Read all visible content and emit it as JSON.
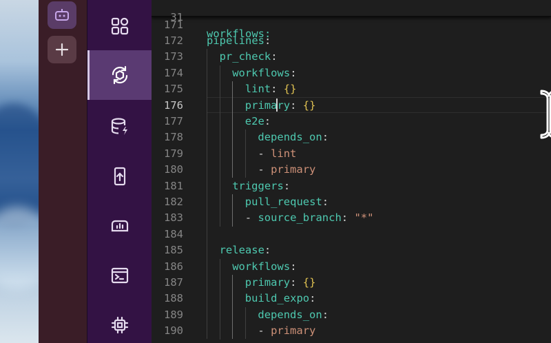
{
  "workspace": {
    "active_icon": "robot-icon",
    "add_icon": "plus-icon"
  },
  "activity_bar": {
    "items": [
      {
        "icon": "apps-grid-icon",
        "active": false
      },
      {
        "icon": "workflow-sync-icon",
        "active": true
      },
      {
        "icon": "database-bolt-icon",
        "active": false
      },
      {
        "icon": "mobile-upload-icon",
        "active": false
      },
      {
        "icon": "dashboard-gauge-icon",
        "active": false
      },
      {
        "icon": "terminal-icon",
        "active": false
      },
      {
        "icon": "chip-icon",
        "active": false
      }
    ],
    "active_color": "#5a3a72",
    "background": "#331244"
  },
  "editor": {
    "sticky": {
      "num": "31",
      "text": "workflows:"
    },
    "current_line": "176",
    "lines": [
      {
        "num": "171",
        "indent": 0,
        "tokens": []
      },
      {
        "num": "172",
        "indent": 0,
        "tokens": [
          {
            "t": "pipelines",
            "c": "k"
          },
          {
            "t": ":",
            "c": "p"
          }
        ]
      },
      {
        "num": "173",
        "indent": 1,
        "tokens": [
          {
            "t": "pr_check",
            "c": "k"
          },
          {
            "t": ":",
            "c": "p"
          }
        ]
      },
      {
        "num": "174",
        "indent": 2,
        "tokens": [
          {
            "t": "workflows",
            "c": "k"
          },
          {
            "t": ":",
            "c": "p"
          }
        ]
      },
      {
        "num": "175",
        "indent": 3,
        "tokens": [
          {
            "t": "lint",
            "c": "k"
          },
          {
            "t": ": ",
            "c": "p"
          },
          {
            "t": "{}",
            "c": "b"
          }
        ]
      },
      {
        "num": "176",
        "indent": 3,
        "tokens": [
          {
            "t": "primary",
            "c": "k"
          },
          {
            "t": ": ",
            "c": "p"
          },
          {
            "t": "{}",
            "c": "b"
          }
        ]
      },
      {
        "num": "177",
        "indent": 3,
        "tokens": [
          {
            "t": "e2e",
            "c": "k"
          },
          {
            "t": ":",
            "c": "p"
          }
        ]
      },
      {
        "num": "178",
        "indent": 4,
        "tokens": [
          {
            "t": "depends_on",
            "c": "k"
          },
          {
            "t": ":",
            "c": "p"
          }
        ]
      },
      {
        "num": "179",
        "indent": 4,
        "tokens": [
          {
            "t": "- ",
            "c": "p"
          },
          {
            "t": "lint",
            "c": "s"
          }
        ]
      },
      {
        "num": "180",
        "indent": 4,
        "tokens": [
          {
            "t": "- ",
            "c": "p"
          },
          {
            "t": "primary",
            "c": "s"
          }
        ]
      },
      {
        "num": "181",
        "indent": 2,
        "tokens": [
          {
            "t": "triggers",
            "c": "k"
          },
          {
            "t": ":",
            "c": "p"
          }
        ]
      },
      {
        "num": "182",
        "indent": 3,
        "tokens": [
          {
            "t": "pull_request",
            "c": "k"
          },
          {
            "t": ":",
            "c": "p"
          }
        ]
      },
      {
        "num": "183",
        "indent": 3,
        "tokens": [
          {
            "t": "- ",
            "c": "p"
          },
          {
            "t": "source_branch",
            "c": "k"
          },
          {
            "t": ": ",
            "c": "p"
          },
          {
            "t": "\"*\"",
            "c": "s"
          }
        ]
      },
      {
        "num": "184",
        "indent": 0,
        "tokens": []
      },
      {
        "num": "185",
        "indent": 1,
        "tokens": [
          {
            "t": "release",
            "c": "k"
          },
          {
            "t": ":",
            "c": "p"
          }
        ]
      },
      {
        "num": "186",
        "indent": 2,
        "tokens": [
          {
            "t": "workflows",
            "c": "k"
          },
          {
            "t": ":",
            "c": "p"
          }
        ]
      },
      {
        "num": "187",
        "indent": 3,
        "tokens": [
          {
            "t": "primary",
            "c": "k"
          },
          {
            "t": ": ",
            "c": "p"
          },
          {
            "t": "{}",
            "c": "b"
          }
        ]
      },
      {
        "num": "188",
        "indent": 3,
        "tokens": [
          {
            "t": "build_expo",
            "c": "k"
          },
          {
            "t": ":",
            "c": "p"
          }
        ]
      },
      {
        "num": "189",
        "indent": 4,
        "tokens": [
          {
            "t": "depends_on",
            "c": "k"
          },
          {
            "t": ":",
            "c": "p"
          }
        ]
      },
      {
        "num": "190",
        "indent": 4,
        "tokens": [
          {
            "t": "- ",
            "c": "p"
          },
          {
            "t": "primary",
            "c": "s"
          }
        ]
      }
    ],
    "colors": {
      "key": "#4ec9b0",
      "string": "#ce9178",
      "brace": "#e0c252",
      "plain": "#d4d4d4"
    }
  },
  "cursor": {
    "icon": "text-cursor-icon"
  }
}
